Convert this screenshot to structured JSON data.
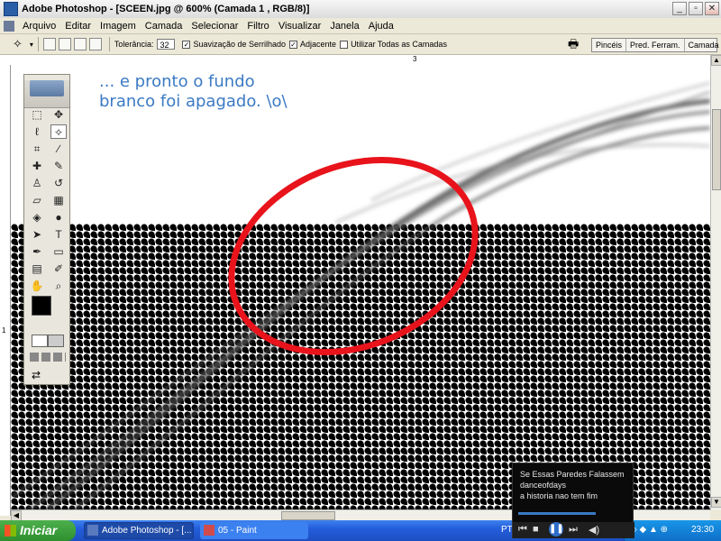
{
  "window": {
    "title": "Adobe Photoshop - [SCEEN.jpg @ 600% (Camada 1 , RGB/8)]",
    "buttons": [
      "_",
      "▫",
      "✕"
    ]
  },
  "menu": [
    "Arquivo",
    "Editar",
    "Imagem",
    "Camada",
    "Selecionar",
    "Filtro",
    "Visualizar",
    "Janela",
    "Ajuda"
  ],
  "options": {
    "tolerance_label": "Tolerância:",
    "tolerance_value": "32",
    "antialias_label": "Suavização de Serrilhado",
    "contiguous_label": "Adjacente",
    "all_layers_label": "Utilizar Todas as Camadas"
  },
  "palette_well": [
    "Pincéis",
    "Pred. Ferram.",
    "Camada"
  ],
  "rulers": {
    "top_mark": "3",
    "left_mark": "1"
  },
  "annotation": {
    "line1": "... e pronto o fundo",
    "line2": "branco foi apagado. \\o\\"
  },
  "player": {
    "line1": "Se Essas Paredes Falassem",
    "line2": "danceofdays",
    "line3": "a historia nao tem fim"
  },
  "taskbar": {
    "start": "Iniciar",
    "tasks": [
      "Adobe Photoshop - [...",
      "05 - Paint"
    ],
    "lang": "PT",
    "clock": "23:30"
  },
  "colors": {
    "annotation": "#3b7ac4",
    "circle": "#e8131b",
    "taskbar": "#245edb"
  }
}
